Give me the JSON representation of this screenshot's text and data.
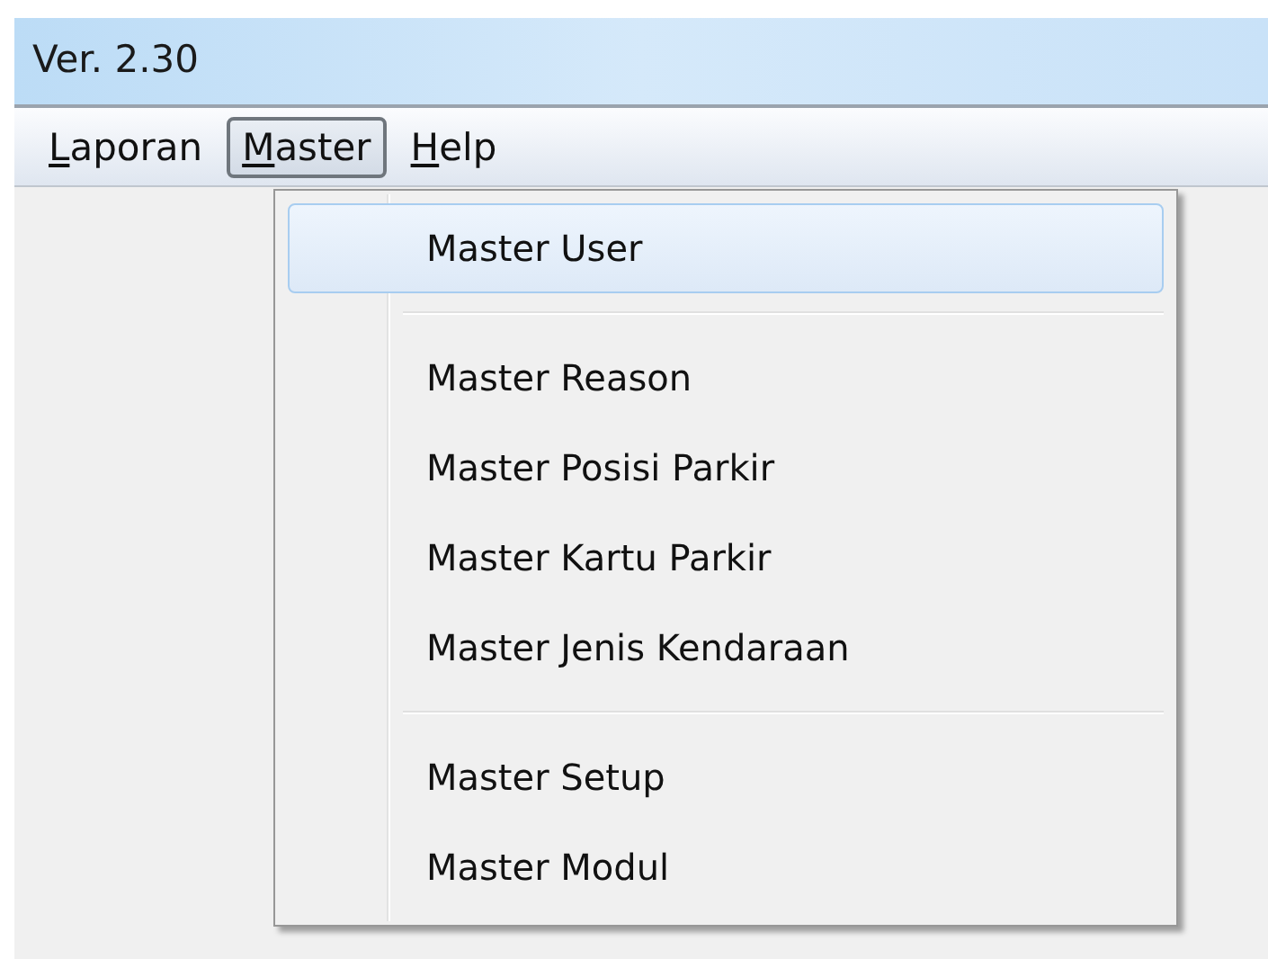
{
  "window": {
    "title": "Ver. 2.30"
  },
  "menu_bar": [
    {
      "label": "Laporan",
      "selected": false
    },
    {
      "label": "Master",
      "selected": true
    },
    {
      "label": "Help",
      "selected": false
    }
  ],
  "dropdown": {
    "groups": [
      [
        {
          "label": "Master User",
          "selected": true
        }
      ],
      [
        {
          "label": "Master Reason",
          "selected": false
        },
        {
          "label": "Master Posisi Parkir",
          "selected": false
        },
        {
          "label": "Master Kartu Parkir",
          "selected": false
        },
        {
          "label": "Master Jenis Kendaraan",
          "selected": false
        }
      ],
      [
        {
          "label": "Master Setup",
          "selected": false
        },
        {
          "label": "Master Modul",
          "selected": false
        }
      ]
    ]
  }
}
